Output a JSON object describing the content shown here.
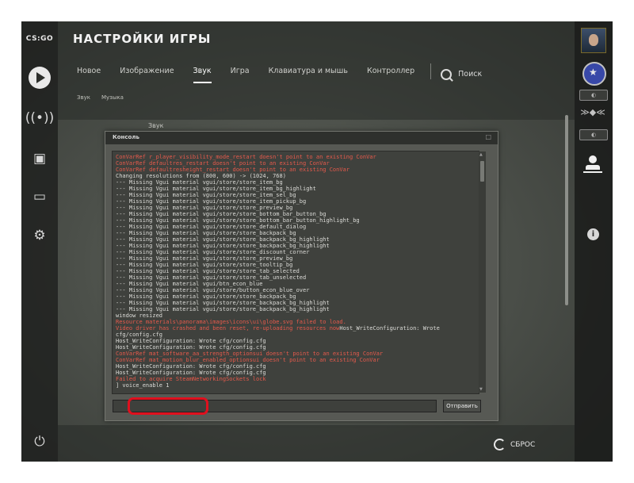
{
  "app": {
    "logo_text": "CS:GO",
    "title": "НАСТРОЙКИ ИГРЫ"
  },
  "left_sidebar": {
    "icons": [
      "play-icon",
      "broadcast-icon",
      "briefcase-icon",
      "tv-icon",
      "gear-icon",
      "power-icon"
    ]
  },
  "tabs": [
    {
      "label": "Новое",
      "active": false
    },
    {
      "label": "Изображение",
      "active": false
    },
    {
      "label": "Звук",
      "active": true
    },
    {
      "label": "Игра",
      "active": false
    },
    {
      "label": "Клавиатура и мышь",
      "active": false
    },
    {
      "label": "Контроллер",
      "active": false
    }
  ],
  "search": {
    "label": "Поиск"
  },
  "subtabs": [
    {
      "label": "Звук",
      "active": true
    },
    {
      "label": "Музыка",
      "active": false
    }
  ],
  "background_section_label": "Звук",
  "reset_button": {
    "label": "СБРОС"
  },
  "right_sidebar": {
    "icons": [
      "avatar",
      "rank-badge-icon",
      "level-indicator",
      "wings-icon",
      "level-indicator",
      "friends-icon",
      "info-icon"
    ]
  },
  "console": {
    "title": "Консоль",
    "close_glyph": "□",
    "submit_label": "Отправить",
    "input_value": "",
    "lines": [
      {
        "text": "ConVarRef r_player_visibility_mode_restart doesn't point to an existing ConVar",
        "color": "red"
      },
      {
        "text": "ConVarRef defaultres_restart doesn't point to an existing ConVar",
        "color": "red"
      },
      {
        "text": "ConVarRef defaultresheight_restart doesn't point to an existing ConVar",
        "color": "red"
      },
      {
        "text": "Changing resolutions from (800, 600) -> (1024, 768)",
        "color": "normal"
      },
      {
        "text": "--- Missing Vgui material vgui/store/store_item_bg",
        "color": "normal"
      },
      {
        "text": "--- Missing Vgui material vgui/store/store_item_bg_highlight",
        "color": "normal"
      },
      {
        "text": "--- Missing Vgui material vgui/store/store_item_sel_bg",
        "color": "normal"
      },
      {
        "text": "--- Missing Vgui material vgui/store/store_item_pickup_bg",
        "color": "normal"
      },
      {
        "text": "--- Missing Vgui material vgui/store/store_preview_bg",
        "color": "normal"
      },
      {
        "text": "--- Missing Vgui material vgui/store/store_bottom_bar_button_bg",
        "color": "normal"
      },
      {
        "text": "--- Missing Vgui material vgui/store/store_bottom_bar_button_highlight_bg",
        "color": "normal"
      },
      {
        "text": "--- Missing Vgui material vgui/store/store_default_dialog",
        "color": "normal"
      },
      {
        "text": "--- Missing Vgui material vgui/store/store_backpack_bg",
        "color": "normal"
      },
      {
        "text": "--- Missing Vgui material vgui/store/store_backpack_bg_highlight",
        "color": "normal"
      },
      {
        "text": "--- Missing Vgui material vgui/store/store_backpack_bg_highlight",
        "color": "normal"
      },
      {
        "text": "--- Missing Vgui material vgui/store/store_discount_corner",
        "color": "normal"
      },
      {
        "text": "--- Missing Vgui material vgui/store/store_preview_bg",
        "color": "normal"
      },
      {
        "text": "--- Missing Vgui material vgui/store/store_tooltip_bg",
        "color": "normal"
      },
      {
        "text": "--- Missing Vgui material vgui/store/store_tab_selected",
        "color": "normal"
      },
      {
        "text": "--- Missing Vgui material vgui/store/store_tab_unselected",
        "color": "normal"
      },
      {
        "text": "--- Missing Vgui material vgui/btn_econ_blue",
        "color": "normal"
      },
      {
        "text": "--- Missing Vgui material vgui/store/button_econ_blue_over",
        "color": "normal"
      },
      {
        "text": "--- Missing Vgui material vgui/store/store_backpack_bg",
        "color": "normal"
      },
      {
        "text": "--- Missing Vgui material vgui/store/store_backpack_bg_highlight",
        "color": "normal"
      },
      {
        "text": "--- Missing Vgui material vgui/store/store_backpack_bg_highlight",
        "color": "normal"
      },
      {
        "text": "window resized",
        "color": "normal"
      },
      {
        "text": "Resource materials\\panorama\\images\\icons\\ui\\globe.svg failed to load.",
        "color": "red"
      },
      {
        "text": "Video driver has crashed and been reset, re-uploading resources now",
        "suffix": "Host_WriteConfiguration: Wrote",
        "color": "red"
      },
      {
        "text": "cfg/config.cfg",
        "color": "normal"
      },
      {
        "text": "Host_WriteConfiguration: Wrote cfg/config.cfg",
        "color": "normal"
      },
      {
        "text": "Host_WriteConfiguration: Wrote cfg/config.cfg",
        "color": "normal"
      },
      {
        "text": "ConVarRef mat_software_aa_strength_optionsui doesn't point to an existing ConVar",
        "color": "red"
      },
      {
        "text": "ConVarRef mat_motion_blur_enabled_optionsui doesn't point to an existing ConVar",
        "color": "red"
      },
      {
        "text": "Host_WriteConfiguration: Wrote cfg/config.cfg",
        "color": "normal"
      },
      {
        "text": "Host_WriteConfiguration: Wrote cfg/config.cfg",
        "color": "normal"
      },
      {
        "text": "Failed to acquire SteamNetworkingSockets lock",
        "color": "red"
      },
      {
        "text": "] voice_enable 1",
        "color": "normal"
      }
    ]
  },
  "highlight_color": "#e0101e",
  "accent_red": "#e65a4c"
}
